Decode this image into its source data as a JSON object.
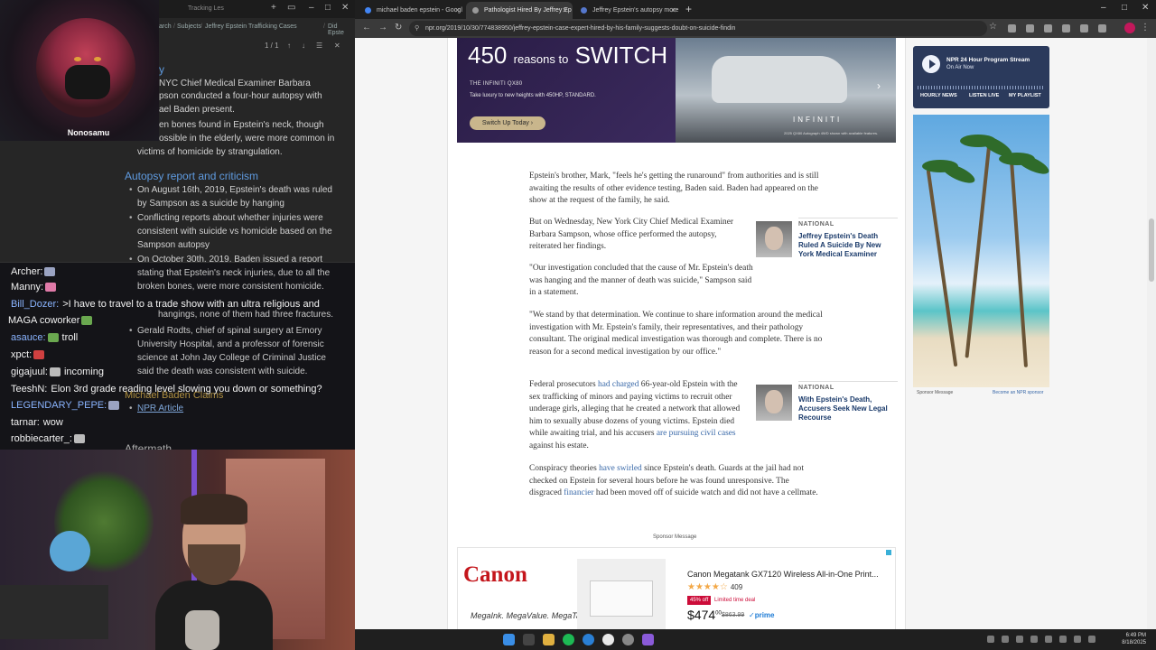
{
  "notes": {
    "tabs": [
      "Tracking Les"
    ],
    "breadcrumb": [
      "arch",
      "Subjects",
      "Jeffrey Epstein Trafficking Cases",
      "Did Epste"
    ],
    "find_count": "1 / 1",
    "lines": [
      "y",
      "NYC Chief Medical Examiner Barbara",
      "pson conducted a four-hour autopsy with",
      "ael Baden present.",
      "en bones found in Epstein's neck, though",
      "ossible in the elderly, were more common in",
      "victims of homicide by strangulation."
    ],
    "heading_autopsy": "Autopsy report and criticism",
    "autopsy_bullets": [
      "On August 16th, 2019, Epstein's death was ruled",
      "by Sampson as a suicide by hanging",
      "Conflicting reports about whether injuries were",
      "consistent with suicide vs homicide based on the",
      "Sampson autopsy",
      "On October 30th, 2019, Baden issued a report",
      "stating that Epstein's neck injuries, due to all the",
      "broken bones, were more consistent homicide.",
      "hangings, none of them had three fractures.",
      "Gerald Rodts, chief of spinal surgery at Emory",
      "University Hospital, and a professor of forensic",
      "science at John Jay College of Criminal Justice",
      "said the death was consistent with suicide."
    ],
    "heading_claims": "Michael Baden Claims",
    "link": "NPR Article",
    "heading_aftermath": "Aftermath"
  },
  "webcam_top": {
    "name": "Nonosamu"
  },
  "chat": [
    {
      "user": "Archer:",
      "color": "#f2f2f2",
      "text": "",
      "emote": "#9aa3c2"
    },
    {
      "user": "Manny:",
      "color": "#f2f2f2",
      "text": "",
      "emote": "#e07aa8"
    },
    {
      "user": "Bill_Dozer:",
      "color": "#8ab4ff",
      "text": ">I have to travel to a trade show with an ultra religious and",
      "emote": ""
    },
    {
      "user": "MAGA coworker",
      "color": "#f2f2f2",
      "text": "",
      "emote": "#6aa84f"
    },
    {
      "user": "asauce:",
      "color": "#8ab4ff",
      "text": "troll",
      "emote": "#6aa84f"
    },
    {
      "user": "xpct:",
      "color": "#f2f2f2",
      "text": "",
      "emote": "#d04040"
    },
    {
      "user": "gigajuul:",
      "color": "#f2f2f2",
      "text": "incoming",
      "emote": "#bbbbbb"
    },
    {
      "user": "TeeshN:",
      "color": "#f2f2f2",
      "text": "Elon 3rd grade reading level slowing you down or something?",
      "emote": ""
    },
    {
      "user": "LEGENDARY_PEPE:",
      "color": "#8ab4ff",
      "text": "",
      "emote": "#9aa3c2"
    },
    {
      "user": "tarnar:",
      "color": "#f2f2f2",
      "text": "wow",
      "emote": ""
    },
    {
      "user": "robbiecarter_:",
      "color": "#f2f2f2",
      "text": "",
      "emote": "#bbbbbb"
    }
  ],
  "browser": {
    "tabs": [
      {
        "label": "michael baden epstein - Googl",
        "active": false,
        "color": "#4285f4"
      },
      {
        "label": "Pathologist Hired By Jeffrey Ep",
        "active": true,
        "color": "#777777"
      },
      {
        "label": "Jeffrey Epstein's autopsy more",
        "active": false,
        "color": "#5577cc"
      }
    ],
    "url": "npr.org/2019/10/30/774838950/jeffrey-epstein-case-expert-hired-by-his-family-suggests-doubt-on-suicide-findin"
  },
  "ad_infiniti": {
    "headline_num": "450",
    "headline_mid": "reasons to",
    "headline_end": "SWITCH UP",
    "model": "THE INFINITI QX80",
    "tagline": "Take luxury to new heights with 450HP, STANDARD.",
    "cta": "Switch Up Today ›",
    "brand": "INFINITI",
    "fine": "2025 QX80 Autograph 4WD shown with available features."
  },
  "article": {
    "p1": "Epstein's brother, Mark, \"feels he's getting the runaround\" from authorities and is still awaiting the results of other evidence testing, Baden said. Baden had appeared on the show at the request of the family, he said.",
    "p2": "But on Wednesday, New York City Chief Medical Examiner Barbara Sampson, whose office performed the autopsy, reiterated her findings.",
    "p3": "\"Our investigation concluded that the cause of Mr. Epstein's death was hanging and the manner of death was suicide,\" Sampson said in a statement.",
    "p4": "\"We stand by that determination. We continue to share information around the medical investigation with Mr. Epstein's family, their representatives, and their pathology consultant. The original medical investigation was thorough and complete. There is no reason for a second medical investigation by our office.\"",
    "p5_a": "Federal prosecutors ",
    "p5_link1": "had charged",
    "p5_b": " 66-year-old Epstein with the sex trafficking of minors and paying victims to recruit other underage girls, alleging that he created a network that allowed him to sexually abuse dozens of young victims. Epstein died while awaiting trial, and his accusers ",
    "p5_link2": "are pursuing civil cases",
    "p5_c": " against his estate.",
    "p6_a": "Conspiracy theories ",
    "p6_link": "have swirled",
    "p6_b": " since Epstein's death. Guards at the jail had not checked on Epstein for several hours before he was found unresponsive. The disgraced ",
    "p6_link2": "financier",
    "p6_c": " had been moved off of suicide watch and did not have a cellmate."
  },
  "related": [
    {
      "label": "NATIONAL",
      "title": "Jeffrey Epstein's Death Ruled A Suicide By New York Medical Examiner"
    },
    {
      "label": "NATIONAL",
      "title": "With Epstein's Death, Accusers Seek New Legal Recourse"
    }
  ],
  "sponsor_label": "Sponsor Message",
  "ad_canon": {
    "logo": "Canon",
    "slogan": "MegaInk. MegaValue. MegaTank.",
    "title": "Canon Megatank GX7120 Wireless All-in-One Print...",
    "stars": "★★★★☆",
    "reviews": "409",
    "discount": "45% off",
    "deal": "Limited time deal",
    "price": "$474",
    "price_cents": "00",
    "was": "$863.99",
    "prime": "✓prime"
  },
  "stream": {
    "title": "NPR 24 Hour Program Stream",
    "status": "On Air Now",
    "links": [
      "HOURLY NEWS",
      "LISTEN LIVE",
      "MY PLAYLIST"
    ]
  },
  "beach_ad": {
    "left": "Sponsor Message",
    "right": "Become an NPR sponsor"
  },
  "clock": {
    "time": "6:49 PM",
    "date": "8/18/2025"
  }
}
